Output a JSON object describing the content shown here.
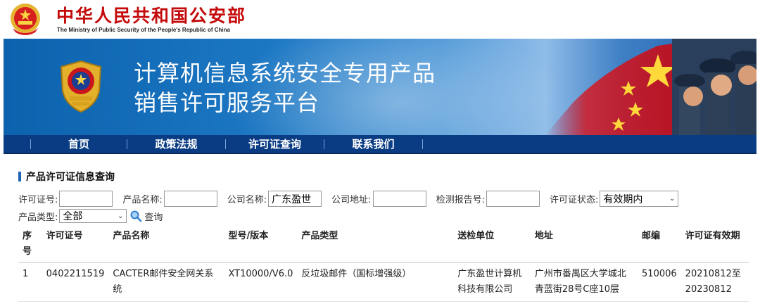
{
  "header": {
    "ministry_cn": "中华人民共和国公安部",
    "ministry_en": "The Ministry of Public Security of the People's Republic of China"
  },
  "banner": {
    "title_line1": "计算机信息系统安全专用产品",
    "title_line2": "销售许可服务平台"
  },
  "nav": {
    "items": [
      "首页",
      "政策法规",
      "许可证查询",
      "联系我们"
    ]
  },
  "section": {
    "title": "产品许可证信息查询"
  },
  "filters": {
    "license_no_label": "许可证号:",
    "license_no_value": "",
    "product_name_label": "产品名称:",
    "product_name_value": "",
    "company_name_label": "公司名称:",
    "company_name_value": "广东盈世",
    "company_addr_label": "公司地址:",
    "company_addr_value": "",
    "report_no_label": "检测报告号:",
    "report_no_value": "",
    "status_label": "许可证状态:",
    "status_value": "有效期内",
    "type_label": "产品类型:",
    "type_value": "全部",
    "search_label": "查询"
  },
  "table": {
    "headers": [
      "序号",
      "许可证号",
      "产品名称",
      "型号/版本",
      "产品类型",
      "送检单位",
      "地址",
      "邮编",
      "许可证有效期"
    ],
    "rows": [
      {
        "seq": "1",
        "license_no": "0402211519",
        "product_name": "CACTER邮件安全网关系统",
        "model": "XT10000/V6.0",
        "product_type": "反垃圾邮件（国标增强级）",
        "submitter": "广东盈世计算机科技有限公司",
        "address": "广州市番禺区大学城北青蓝街28号C座10层",
        "postcode": "510006",
        "validity": "20210812至20230812"
      }
    ]
  },
  "colors": {
    "ministry_red": "#c40a0a",
    "nav_blue": "#0a3c83",
    "banner_blue": "#1c77c3",
    "accent_bar": "#1c65b5"
  }
}
